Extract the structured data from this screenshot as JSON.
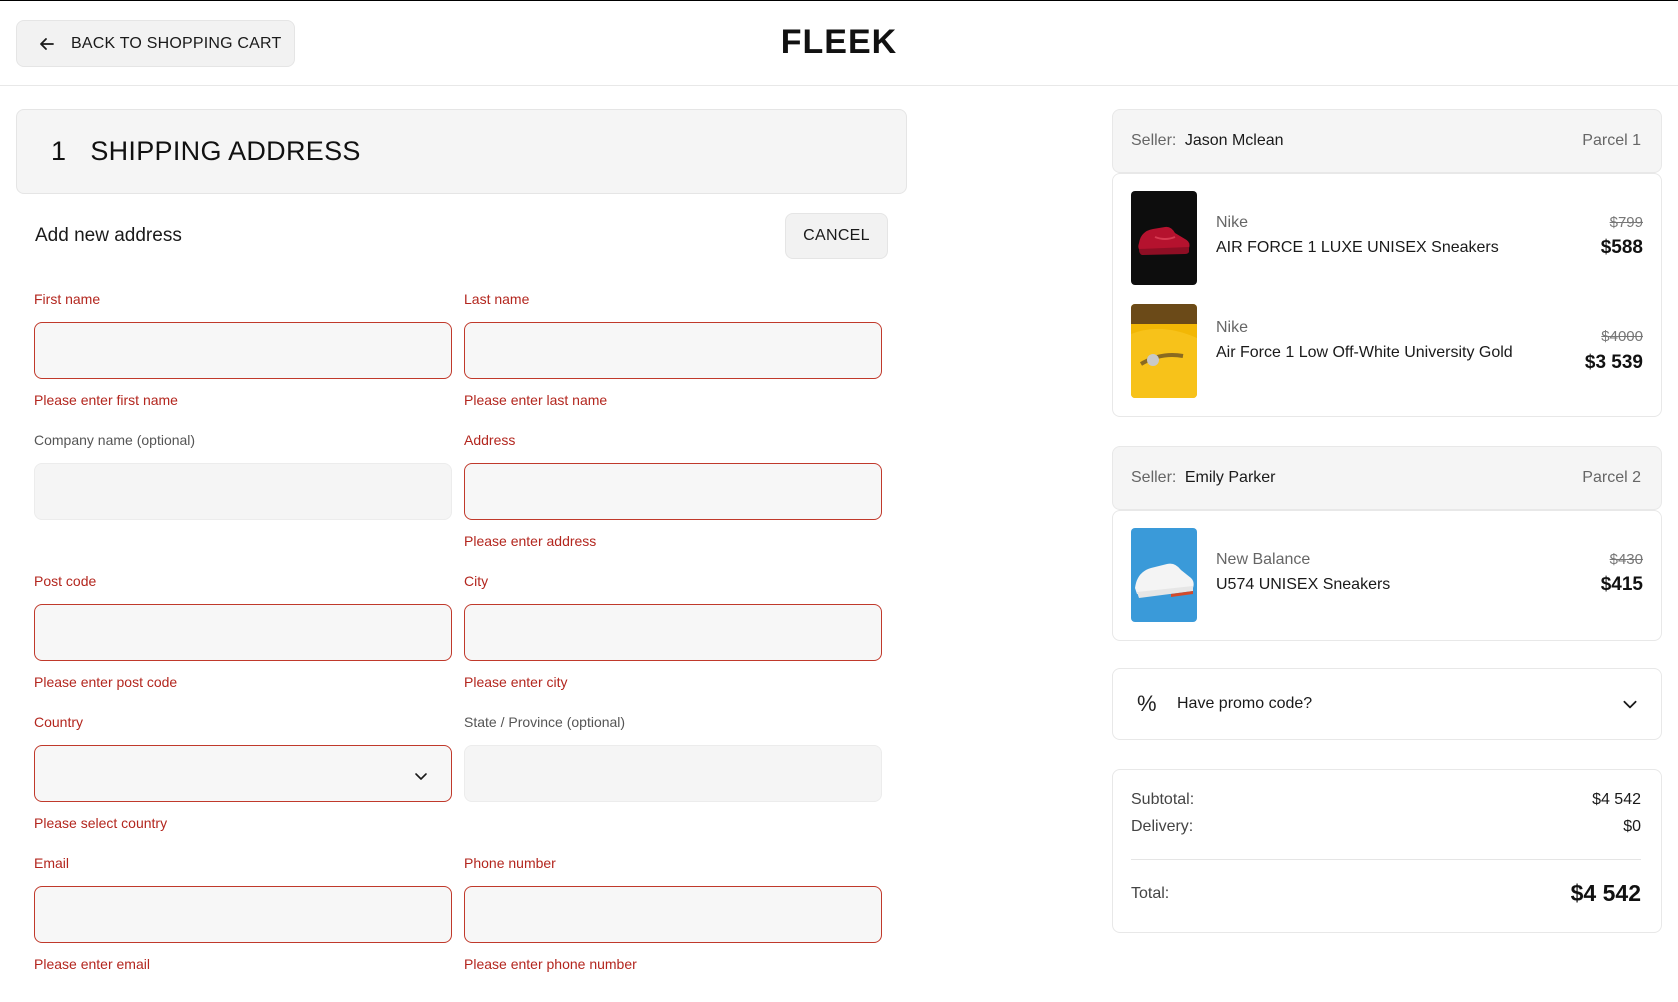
{
  "header": {
    "back_label": "BACK TO SHOPPING CART",
    "logo": "FLEEK"
  },
  "step": {
    "number": "1",
    "title": "SHIPPING ADDRESS"
  },
  "form": {
    "title": "Add new address",
    "cancel_label": "CANCEL",
    "first_name": {
      "label": "First name",
      "value": "",
      "error": "Please enter first name"
    },
    "last_name": {
      "label": "Last name",
      "value": "",
      "error": "Please enter last name"
    },
    "company": {
      "label": "Company name (optional)",
      "value": ""
    },
    "address": {
      "label": "Address",
      "value": "",
      "error": "Please enter address"
    },
    "post_code": {
      "label": "Post code",
      "value": "",
      "error": "Please enter post code"
    },
    "city": {
      "label": "City",
      "value": "",
      "error": "Please enter city"
    },
    "country": {
      "label": "Country",
      "value": "",
      "error": "Please select country"
    },
    "state": {
      "label": "State / Province (optional)",
      "value": ""
    },
    "email": {
      "label": "Email",
      "value": "",
      "error": "Please enter email"
    },
    "phone": {
      "label": "Phone number",
      "value": "",
      "error": "Please enter phone number"
    }
  },
  "parcels": [
    {
      "seller_label": "Seller:",
      "seller_name": "Jason Mclean",
      "parcel": "Parcel 1",
      "items": [
        {
          "brand": "Nike",
          "name": "AIR FORCE 1 LUXE UNISEX Sneakers",
          "old_price": "$799",
          "price": "$588"
        },
        {
          "brand": "Nike",
          "name": "Air Force 1 Low Off-White University Gold",
          "old_price": "$4000",
          "price": "$3 539"
        }
      ]
    },
    {
      "seller_label": "Seller:",
      "seller_name": "Emily Parker",
      "parcel": "Parcel 2",
      "items": [
        {
          "brand": "New Balance",
          "name": "U574 UNISEX Sneakers",
          "old_price": "$430",
          "price": "$415"
        }
      ]
    }
  ],
  "promo": {
    "label": "Have promo code?",
    "icon": "percent-icon"
  },
  "summary": {
    "subtotal_label": "Subtotal:",
    "subtotal": "$4 542",
    "delivery_label": "Delivery:",
    "delivery": "$0",
    "total_label": "Total:",
    "total": "$4 542"
  },
  "colors": {
    "error": "#b3261e",
    "panel": "#f5f5f5"
  }
}
